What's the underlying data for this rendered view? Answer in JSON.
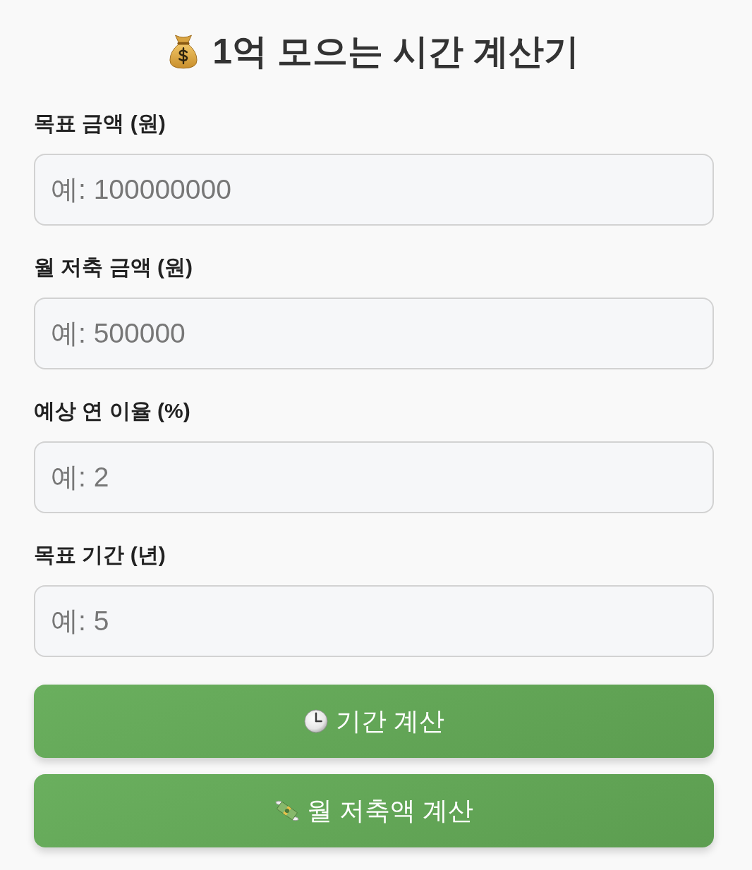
{
  "title": "1억 모으는 시간 계산기",
  "fields": [
    {
      "label": "목표 금액 (원)",
      "placeholder": "예: 100000000"
    },
    {
      "label": "월 저축 금액 (원)",
      "placeholder": "예: 500000"
    },
    {
      "label": "예상 연 이율 (%)",
      "placeholder": "예: 2"
    },
    {
      "label": "목표 기간 (년)",
      "placeholder": "예: 5"
    }
  ],
  "buttons": [
    {
      "kind": "duration",
      "label": "기간 계산"
    },
    {
      "kind": "monthly",
      "label": "월 저축액 계산"
    }
  ]
}
